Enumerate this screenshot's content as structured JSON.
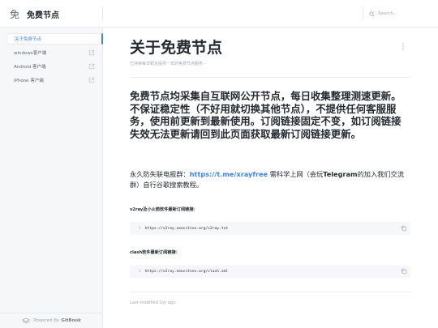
{
  "header": {
    "logo_glyph": "免",
    "site_title": "免费节点",
    "search_placeholder": "Search..."
  },
  "sidebar": {
    "items": [
      {
        "label": "关于免费节点",
        "active": true
      },
      {
        "label": "windows客户端",
        "external": true
      },
      {
        "label": "Android 客户端",
        "external": true
      },
      {
        "label": "iPhone 客户端",
        "external": true
      }
    ],
    "powered_by": "Powered By",
    "powered_brand": "GitBook"
  },
  "main": {
    "title": "关于免费节点",
    "description": "已持续每日稳定提供一年的免费节点服务 -",
    "lead": "免费节点均采集自互联网公开节点，每日收集整理测速更新。不保证稳定性（不好用就切换其他节点），不提供任何客服服务，使用前更新到最新使用。订阅链接固定不变，如订阅链接失效无法更新请回到此页面获取最新订阅链接更新。",
    "para_prefix": "永久防失联电报群：",
    "para_link": "https://t.me/xrayfree",
    "para_mid": " 需科学上网（会玩",
    "para_strong": "Telegram",
    "para_suffix": "的加入我们交流群）自行谷歌搜索教程。",
    "v2ray_heading": "v2ray及小火箭软件最新订阅链接：",
    "v2ray_line_no": "1",
    "v2ray_url": "https://v2ray.neocities.org/v2ray.txt",
    "clash_heading": "clash软件最新订阅链接：",
    "clash_line_no": "1",
    "clash_url": "https://v2ray.neocities.org/clash.xml",
    "last_modified": "Last modified 1yr ago"
  },
  "colors": {
    "accent": "#3884ff",
    "text": "#242a31",
    "muted": "#9daab6",
    "sidebar_bg": "#f5f7f9"
  }
}
